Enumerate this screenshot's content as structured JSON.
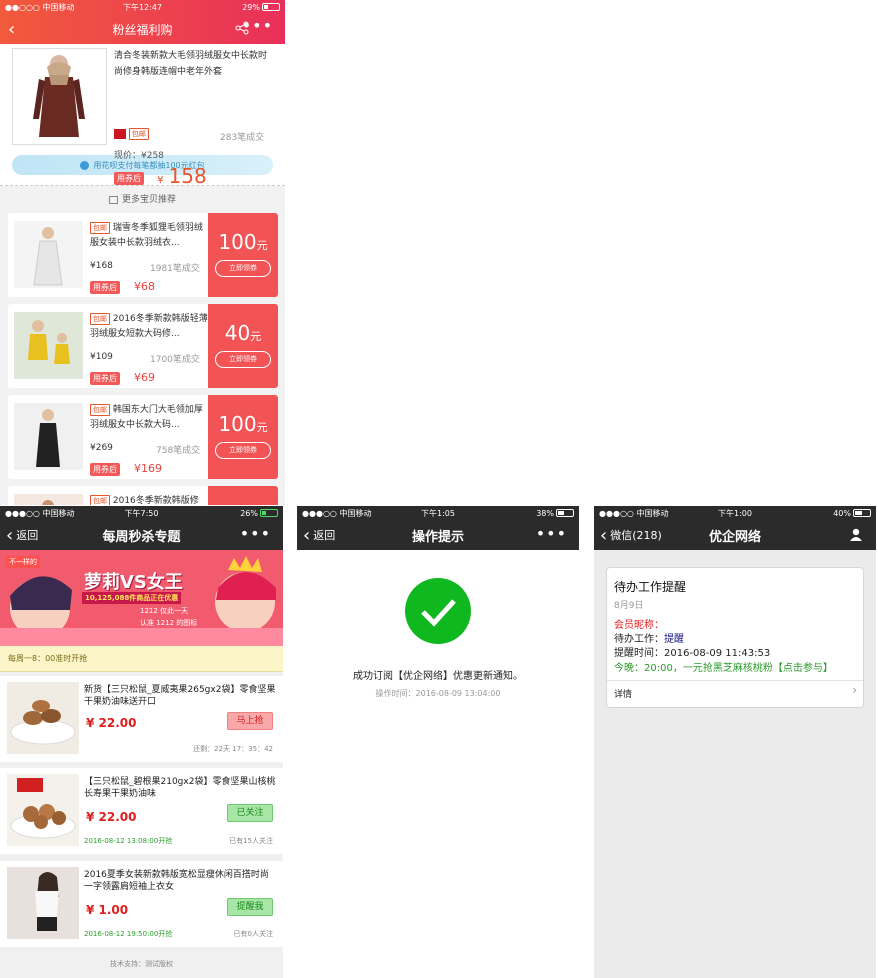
{
  "screen1": {
    "status": {
      "carrier": "●●○○○ 中国移动",
      "time": "下午12:47",
      "battery": "29%"
    },
    "title": "粉丝福利购",
    "product": {
      "name": "清合冬装新款大毛领羽绒服女中长款时尚修身韩版连帽中老年外套",
      "badge": "包邮",
      "sold": "283笔成交",
      "current_price": "现价：¥258",
      "after_coupon_label": "用券后",
      "currency": "¥",
      "after_coupon_price": "158"
    },
    "huabei": "用花呗支付每笔都抽100元红包",
    "more_title": "更多宝贝推荐",
    "items": [
      {
        "badge": "包邮",
        "name": "瑞雪冬季狐狸毛领羽绒服女装中长款羽绒衣...",
        "price": "¥168",
        "sold": "1981笔成交",
        "after_label": "用券后",
        "after": "¥68",
        "coupon": "100",
        "unit": "元",
        "btn": "立即领券",
        "color": "#e8e8e8"
      },
      {
        "badge": "包邮",
        "name": "2016冬季新款韩版轻薄羽绒服女短款大码修...",
        "price": "¥109",
        "sold": "1700笔成交",
        "after_label": "用券后",
        "after": "¥69",
        "coupon": "40",
        "unit": "元",
        "btn": "立即领券",
        "color": "#e8c020"
      },
      {
        "badge": "包邮",
        "name": "韩国东大门大毛领加厚羽绒服女中长款大码...",
        "price": "¥269",
        "sold": "758笔成交",
        "after_label": "用券后",
        "after": "¥169",
        "coupon": "100",
        "unit": "元",
        "btn": "立即领券",
        "color": "#222222"
      },
      {
        "badge": "包邮",
        "name": "2016冬季新款韩版修",
        "color": "#d8a080"
      }
    ]
  },
  "screen2": {
    "status": {
      "carrier": "●●●○○ 中国移动",
      "time": "下午7:50",
      "battery": "26%"
    },
    "back": "返回",
    "title": "每周秒杀专题",
    "banner": {
      "corner": "不一样的",
      "headline": "萝莉VS女王",
      "sub": "10,125,088件商品正在优惠",
      "badge1": "1212 仅此一天",
      "badge2": "认准 1212 的图标"
    },
    "notice": "每周一8：00准时开抢",
    "items": [
      {
        "name": "新货【三只松鼠_夏威夷果265gx2袋】零食坚果干果奶油味送开口",
        "price": "¥ 22.00",
        "btn": "马上抢",
        "left": "还剩：22天 17：35：42",
        "right": ""
      },
      {
        "name": "【三只松鼠_碧根果210gx2袋】零食坚果山核桃长寿果干果奶油味",
        "price": "¥ 22.00",
        "btn": "已关注",
        "left": "2016-08-12 13:08:00开抢",
        "right": "已有15人关注"
      },
      {
        "name": "2016夏季女装新款韩版宽松显瘦休闲百搭时尚一字领露肩短袖上衣女",
        "price": "¥ 1.00",
        "btn": "提醒我",
        "left": "2016-08-12 19:50:00开抢",
        "right": "已有0人关注"
      }
    ],
    "footer": "技术支持：测试版权"
  },
  "screen3": {
    "status": {
      "carrier": "●●●○○ 中国移动",
      "time": "下午1:05",
      "battery": "38%"
    },
    "back": "返回",
    "title": "操作提示",
    "message": "成功订阅【优企网络】优惠更新通知。",
    "time_label": "操作时间：2016-08-09 13:04:00"
  },
  "screen4": {
    "status": {
      "carrier": "●●●○○ 中国移动",
      "time": "下午1:00",
      "battery": "40%"
    },
    "back": "微信(218)",
    "title": "优企网络",
    "card": {
      "title": "待办工作提醒",
      "date": "8月9日",
      "nick": "会员昵称：",
      "work_label": "待办工作：",
      "work": "提醒",
      "time": "提醒时间：2016-08-09 11:43:53",
      "tonight": "今晚：20:00，一元抢黑芝麻核桃粉【点击参与】",
      "detail": "详情"
    }
  }
}
